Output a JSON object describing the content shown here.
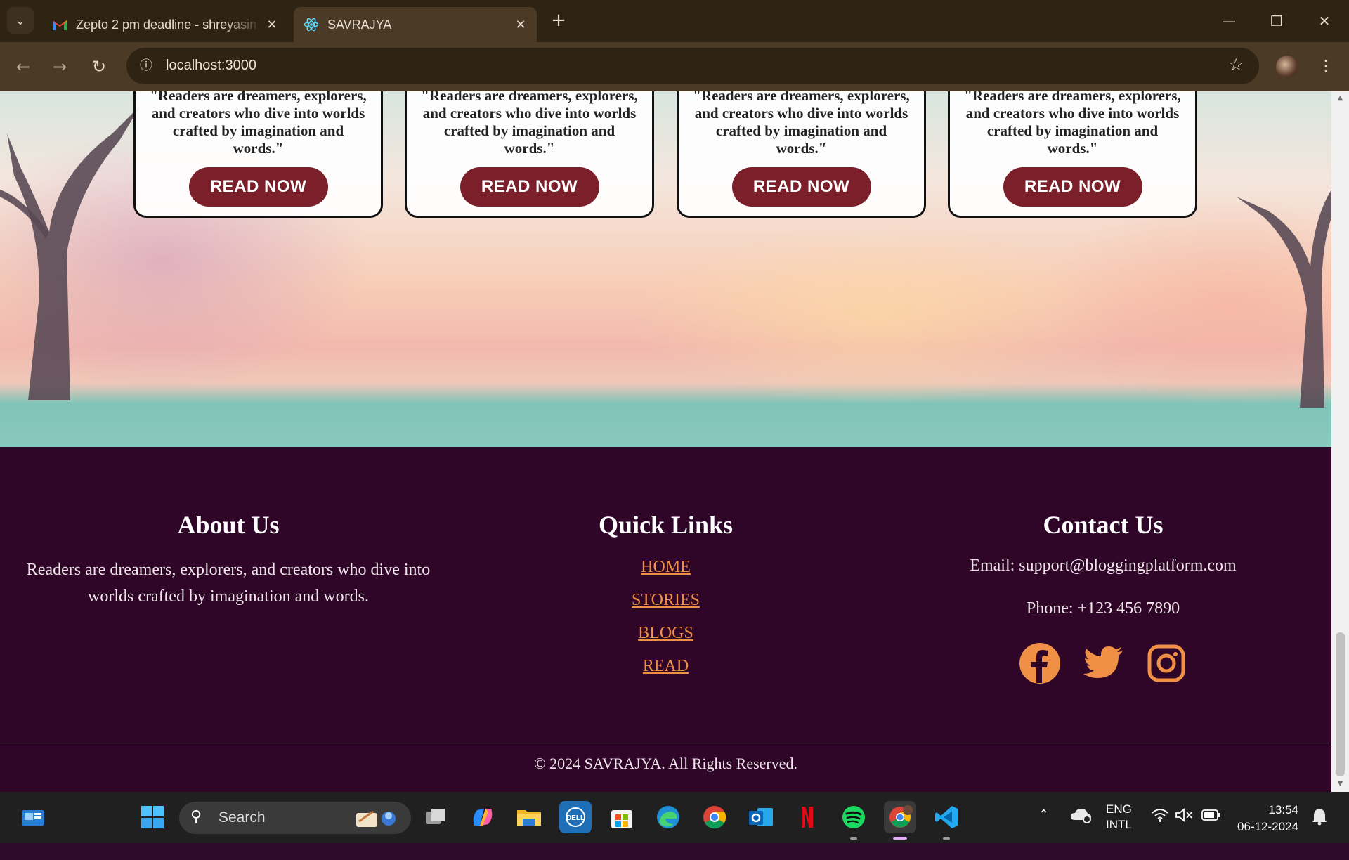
{
  "browser": {
    "tabs": [
      {
        "title": "Zepto 2 pm deadline - shreyasin",
        "icon": "gmail-icon",
        "active": false
      },
      {
        "title": "SAVRAJYA",
        "icon": "react-icon",
        "active": true
      }
    ],
    "url": "localhost:3000",
    "icons": {
      "back": "arrow-left-icon",
      "forward": "arrow-right-icon",
      "reload": "reload-icon",
      "site_info": "info-icon",
      "bookmark": "star-icon",
      "menu": "kebab-icon"
    }
  },
  "cards": [
    {
      "quote": "\"Readers are dreamers, explorers, and creators who dive into worlds crafted by imagination and words.\"",
      "button": "READ NOW"
    },
    {
      "quote": "\"Readers are dreamers, explorers, and creators who dive into worlds crafted by imagination and words.\"",
      "button": "READ NOW"
    },
    {
      "quote": "\"Readers are dreamers, explorers, and creators who dive into worlds crafted by imagination and words.\"",
      "button": "READ NOW"
    },
    {
      "quote": "\"Readers are dreamers, explorers, and creators who dive into worlds crafted by imagination and words.\"",
      "button": "READ NOW"
    }
  ],
  "footer": {
    "about": {
      "title": "About Us",
      "text": "Readers are dreamers, explorers, and creators who dive into worlds crafted by imagination and words."
    },
    "quick_links": {
      "title": "Quick Links",
      "links": [
        "HOME",
        "STORIES",
        "BLOGS",
        "READ"
      ]
    },
    "contact": {
      "title": "Contact Us",
      "email": "Email: support@bloggingplatform.com",
      "phone": "Phone: +123 456 7890",
      "social": [
        "facebook-icon",
        "twitter-icon",
        "instagram-icon"
      ]
    },
    "copyright": "© 2024 SAVRAJYA. All Rights Reserved."
  },
  "colors": {
    "footer_bg": "#2f0628",
    "link": "#f09046",
    "button": "#7b1f2a"
  },
  "taskbar": {
    "search_label": "Search",
    "apps": [
      "outlook-news-icon",
      "windows-start-icon",
      "task-view-icon",
      "copilot-icon",
      "file-explorer-icon",
      "dell-icon",
      "microsoft-store-icon",
      "edge-icon",
      "chrome-icon",
      "outlook-icon",
      "netflix-icon",
      "spotify-icon",
      "chrome-profile-icon",
      "vscode-icon"
    ],
    "language_line1": "ENG",
    "language_line2": "INTL",
    "time": "13:54",
    "date": "06-12-2024"
  }
}
